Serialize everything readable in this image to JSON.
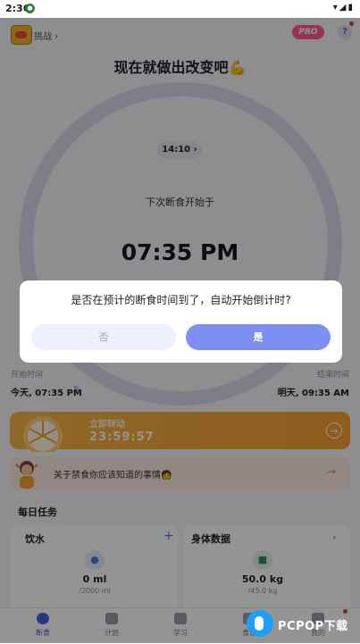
{
  "status_bar": {
    "time": "2:36",
    "notification_icon": "circle-icon",
    "signal_icons": "wifi-icon, signal-icon, battery-icon"
  },
  "header": {
    "challenge_label": "挑战 ›",
    "pro_label": "PRO",
    "help_label": "?",
    "headline": "现在就做出改变吧💪"
  },
  "timer": {
    "chip_time": "14:10 ›",
    "next_label": "下次断食开始于",
    "big_time": "07:35 PM"
  },
  "schedule": {
    "start_label": "开始时间",
    "start_value": "今天, 07:35 PM",
    "end_label": "结束时间",
    "end_value": "明天, 09:35 AM"
  },
  "transition_banner": {
    "label": "立即转动",
    "countdown": "23:59:57",
    "arrow": "→"
  },
  "tip": {
    "text": "关于禁食你应该知道的事情🧑",
    "arrow": "→"
  },
  "daily_tasks": {
    "title": "每日任务",
    "water": {
      "title": "饮水",
      "value": "0 ml",
      "sub": "/2000 ml",
      "add": "+"
    },
    "body": {
      "title": "身体数据",
      "value": "50.0 kg",
      "sub": "/45.0 kg",
      "arrow": "›"
    }
  },
  "bottom_nav": [
    {
      "label": "断食",
      "icon": "timer-icon",
      "active": true
    },
    {
      "label": "计划",
      "icon": "book-icon"
    },
    {
      "label": "学习",
      "icon": "document-icon"
    },
    {
      "label": "食谱",
      "icon": "chef-icon"
    },
    {
      "label": "我的",
      "icon": "profile-icon"
    }
  ],
  "dialog": {
    "message": "是否在预计的断食时间到了，自动开始倒计时?",
    "no_label": "否",
    "yes_label": "是"
  },
  "watermark": {
    "text": "PCPOP下载"
  },
  "colors": {
    "accent": "#7c8ff2",
    "banner": "#f4a031",
    "ring": "#d8dae8",
    "pro": "#ff5c8d"
  }
}
